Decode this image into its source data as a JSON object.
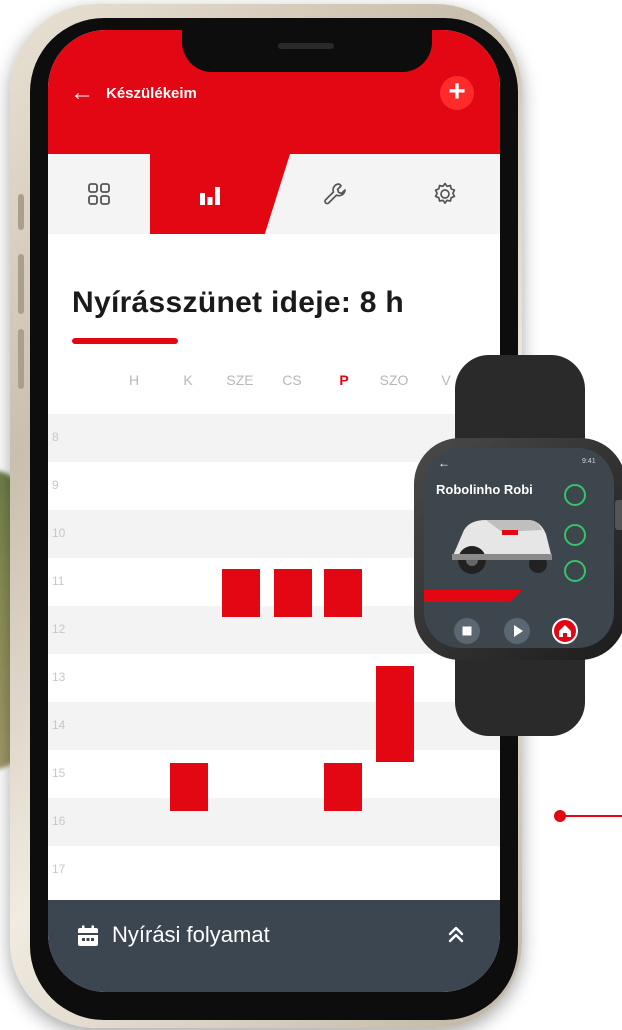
{
  "header": {
    "title": "Készülékeim",
    "back_icon": "arrow-left-icon",
    "add_icon": "plus-icon",
    "color": "#e30613"
  },
  "tabs": [
    {
      "name": "grid",
      "icon": "grid-icon",
      "active": false
    },
    {
      "name": "stats",
      "icon": "bar-chart-icon",
      "active": true
    },
    {
      "name": "tools",
      "icon": "wrench-icon",
      "active": false
    },
    {
      "name": "settings",
      "icon": "gear-icon",
      "active": false
    }
  ],
  "main": {
    "title": "Nyírásszünet ideje: 8 h",
    "days": [
      {
        "label": "H",
        "active": false
      },
      {
        "label": "K",
        "active": false
      },
      {
        "label": "SZE",
        "active": false
      },
      {
        "label": "CS",
        "active": false
      },
      {
        "label": "P",
        "active": true
      },
      {
        "label": "SZO",
        "active": false
      },
      {
        "label": "V",
        "active": false
      }
    ],
    "hours": [
      "8",
      "9",
      "10",
      "11",
      "12",
      "13",
      "14",
      "15",
      "16",
      "17"
    ],
    "pauses": [
      {
        "day": "K",
        "start": 15,
        "end": 16
      },
      {
        "day": "SZE",
        "start": 11,
        "end": 12
      },
      {
        "day": "CS",
        "start": 11,
        "end": 12
      },
      {
        "day": "P",
        "start": 11,
        "end": 12
      },
      {
        "day": "P",
        "start": 15,
        "end": 16
      },
      {
        "day": "SZO",
        "start": 13,
        "end": 15
      }
    ]
  },
  "bottom_bar": {
    "label": "Nyírási folyamat",
    "icon": "calendar-icon",
    "expand_icon": "double-chevron-up-icon"
  },
  "watch": {
    "title": "Robolinho Robi",
    "back_icon": "arrow-left-icon",
    "time": "9:41",
    "buttons": [
      "stop-icon",
      "play-icon",
      "home-icon"
    ]
  }
}
